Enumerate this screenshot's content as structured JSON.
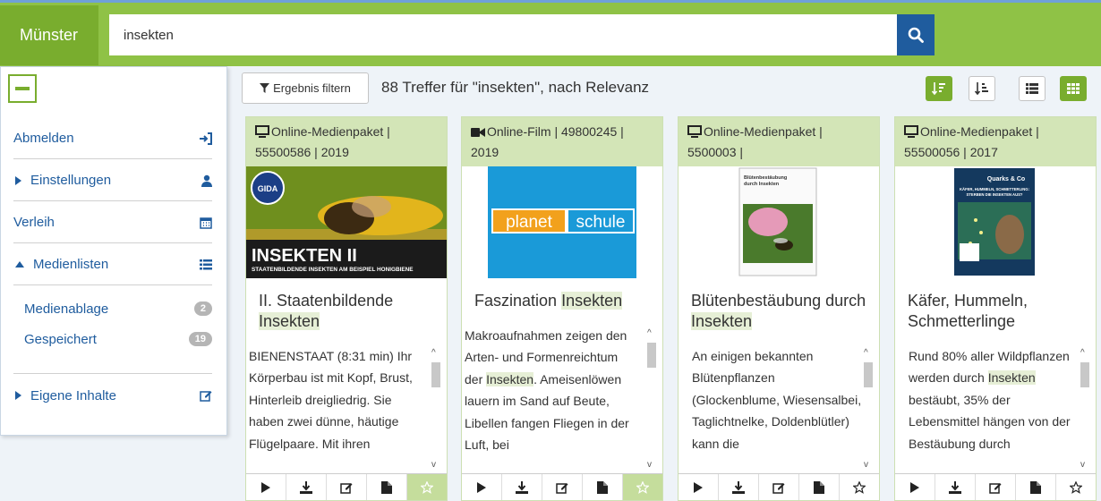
{
  "header": {
    "brand": "Münster",
    "search_value": "insekten"
  },
  "sidebar": {
    "items": [
      {
        "label": "Abmelden"
      },
      {
        "label": "Einstellungen"
      },
      {
        "label": "Verleih"
      },
      {
        "label": "Medienlisten"
      }
    ],
    "sub_items": [
      {
        "label": "Medienablage",
        "count": "2"
      },
      {
        "label": "Gespeichert",
        "count": "19"
      }
    ],
    "own": {
      "label": "Eigene Inhalte"
    }
  },
  "results": {
    "filter_label": "Ergebnis filtern",
    "summary": "88 Treffer für \"insekten\", nach Relevanz"
  },
  "cards": [
    {
      "type_icon": "monitor-icon",
      "meta_line1": "Online-Medienpaket |",
      "meta_line2": "55500586 | 2019",
      "title_pre": "II. Staatenbildende",
      "title_hl": "Insekten",
      "title_post": "",
      "desc_pre": "BIENENSTAAT (8:31 min) Ihr Körperbau ist mit Kopf, Brust, Hinterleib dreigliedrig. Sie haben zwei dünne, häutige Flügelpaare. Mit ihren",
      "desc_hl": "",
      "desc_post": "",
      "image": {
        "brand": "GIDA",
        "line1": "INSEKTEN II",
        "line2": "STAATENBILDENDE INSEKTEN AM BEISPIEL HONIGBIENE"
      },
      "starred": true
    },
    {
      "type_icon": "film-camera-icon",
      "meta_line1": "Online-Film | 49800245 |",
      "meta_line2": "2019",
      "title_pre": "Faszination",
      "title_hl": "Insekten",
      "title_post": "",
      "desc_pre": "Makroaufnahmen zeigen den Arten- und Formenreichtum der",
      "desc_hl": "Insekten",
      "desc_post": ". Ameisenlöwen lauern im Sand auf Beute, Libellen fangen Fliegen in der Luft, bei",
      "image": {
        "word1": "planet",
        "word2": "schule"
      },
      "starred": true
    },
    {
      "type_icon": "monitor-icon",
      "meta_line1": "Online-Medienpaket |",
      "meta_line2": "5500003 |",
      "title_pre": "Blütenbestäubung durch",
      "title_hl": "Insekten",
      "title_post": "",
      "desc_pre": "An einigen bekannten Blütenpflanzen (Glockenblume, Wiesensalbei, Taglichtnelke, Doldenblütler) kann die",
      "desc_hl": "",
      "desc_post": "",
      "image": {
        "line1": "Blütenbestäubung",
        "line2": "durch Insekten"
      },
      "starred": false
    },
    {
      "type_icon": "monitor-icon",
      "meta_line1": "Online-Medienpaket |",
      "meta_line2": "55500056 | 2017",
      "title_pre": "Käfer, Hummeln, Schmetterlinge",
      "title_hl": "",
      "title_post": "",
      "desc_pre": "Rund 80% aller Wildpflanzen werden durch",
      "desc_hl": "Insekten",
      "desc_post": " bestäubt, 35% der Lebensmittel hängen von der Bestäubung durch",
      "image": {
        "brand": "Quarks & Co",
        "line1": "KÄFER, HUMMELN, SCHMETTERLING:",
        "line2": "STERBEN DIE INSEKTEN AUS?"
      },
      "starred": false
    }
  ],
  "colors": {
    "brand_green": "#79ad2e",
    "bar_green": "#8fc246",
    "link_blue": "#1f5c9e",
    "card_head": "#d3e5b7"
  }
}
